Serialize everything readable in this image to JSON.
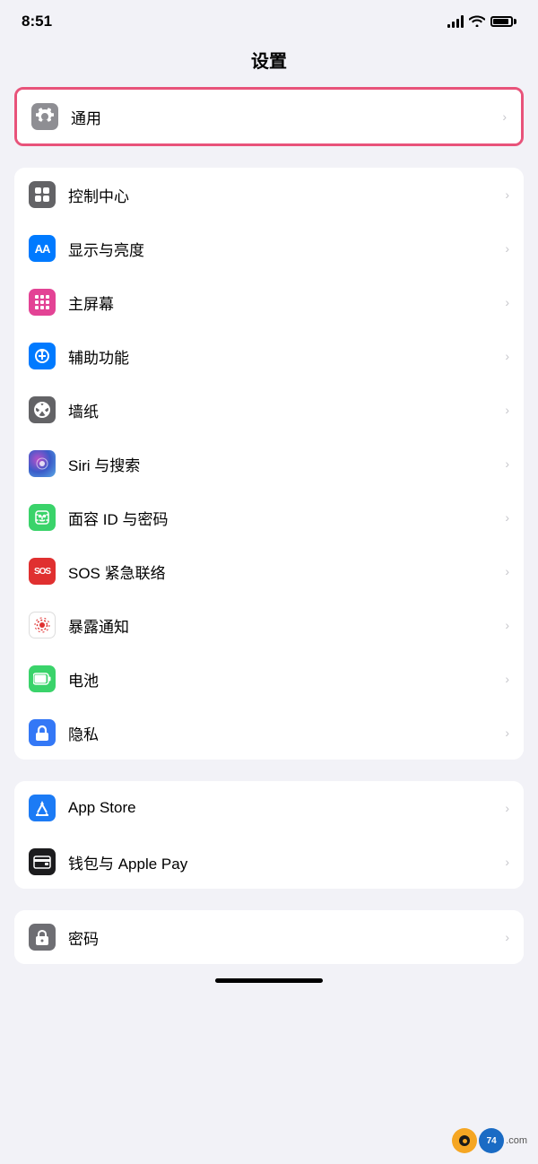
{
  "statusBar": {
    "time": "8:51"
  },
  "pageTitle": "设置",
  "sections": [
    {
      "id": "general-section",
      "highlighted": true,
      "rows": [
        {
          "id": "general",
          "label": "通用",
          "iconType": "gear",
          "iconColor": "icon-gray"
        }
      ]
    },
    {
      "id": "display-section",
      "highlighted": false,
      "rows": [
        {
          "id": "control-center",
          "label": "控制中心",
          "iconType": "control",
          "iconColor": "icon-gray2"
        },
        {
          "id": "display",
          "label": "显示与亮度",
          "iconType": "display",
          "iconColor": "icon-blue"
        },
        {
          "id": "home-screen",
          "label": "主屏幕",
          "iconType": "home",
          "iconColor": "icon-pink"
        },
        {
          "id": "accessibility",
          "label": "辅助功能",
          "iconType": "accessibility",
          "iconColor": "icon-accessibility"
        },
        {
          "id": "wallpaper",
          "label": "墙纸",
          "iconType": "flower",
          "iconColor": "icon-flower"
        },
        {
          "id": "siri",
          "label": "Siri 与搜索",
          "iconType": "siri",
          "iconColor": "icon-siri"
        },
        {
          "id": "faceid",
          "label": "面容 ID 与密码",
          "iconType": "faceid",
          "iconColor": "icon-faceid"
        },
        {
          "id": "sos",
          "label": "SOS 紧急联络",
          "iconType": "sos",
          "iconColor": "icon-sos"
        },
        {
          "id": "exposure",
          "label": "暴露通知",
          "iconType": "exposure",
          "iconColor": "icon-exposure"
        },
        {
          "id": "battery",
          "label": "电池",
          "iconType": "battery",
          "iconColor": "icon-battery"
        },
        {
          "id": "privacy",
          "label": "隐私",
          "iconType": "privacy",
          "iconColor": "icon-privacy"
        }
      ]
    },
    {
      "id": "store-section",
      "highlighted": false,
      "rows": [
        {
          "id": "appstore",
          "label": "App Store",
          "iconType": "appstore",
          "iconColor": "icon-appstore"
        },
        {
          "id": "wallet",
          "label": "钱包与 Apple Pay",
          "iconType": "wallet",
          "iconColor": "icon-wallet"
        }
      ]
    },
    {
      "id": "password-section",
      "highlighted": false,
      "rows": [
        {
          "id": "passwords",
          "label": "密码",
          "iconType": "password",
          "iconColor": "icon-password"
        }
      ]
    }
  ]
}
